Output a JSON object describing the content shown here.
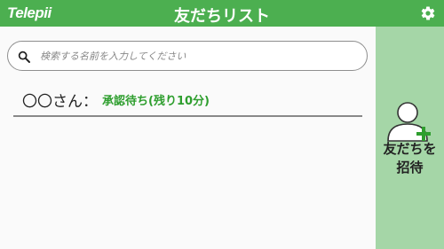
{
  "header": {
    "logo": "Telepii",
    "title": "友だちリスト",
    "settings_icon": "gear-icon"
  },
  "search": {
    "placeholder": "検索する名前を入力してください",
    "value": "",
    "icon": "search-icon"
  },
  "friends": [
    {
      "name": "〇〇さん：",
      "status": "承認待ち(残り10分)"
    }
  ],
  "invite": {
    "label_line1": "友だちを",
    "label_line2": "招待",
    "icon": "add-person-icon"
  },
  "colors": {
    "header_bg": "#4caf50",
    "invite_bg": "#a5d6a7",
    "status_text": "#2e9e2e"
  }
}
